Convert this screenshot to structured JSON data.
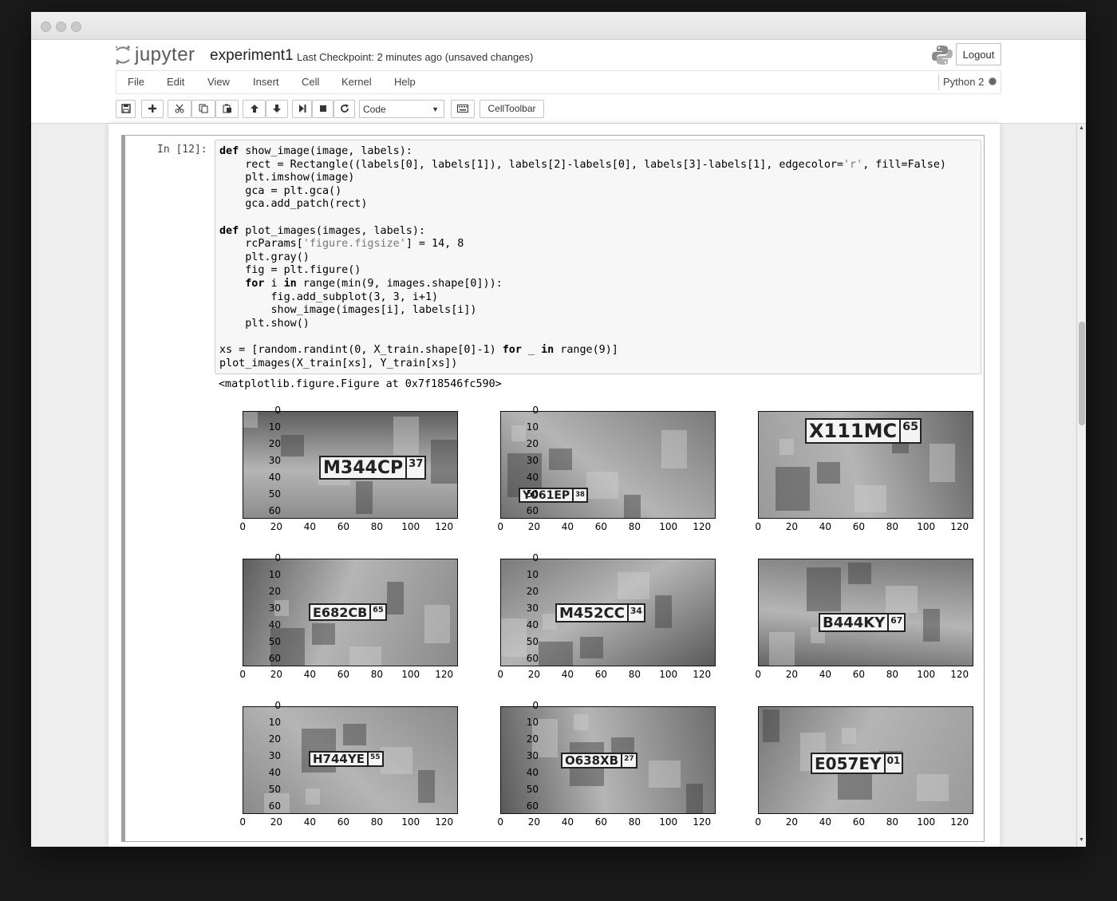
{
  "header": {
    "logo_text": "jupyter",
    "notebook_name": "experiment1",
    "checkpoint": "Last Checkpoint: 2 minutes ago (unsaved changes)",
    "logout_label": "Logout"
  },
  "menu": {
    "items": [
      "File",
      "Edit",
      "View",
      "Insert",
      "Cell",
      "Kernel",
      "Help"
    ],
    "kernel_name": "Python 2"
  },
  "toolbar": {
    "buttons": [
      "save-icon",
      "plus-icon",
      "scissors-icon",
      "copy-icon",
      "paste-icon",
      "arrow-up-icon",
      "arrow-down-icon",
      "step-forward-icon",
      "stop-icon",
      "refresh-icon",
      "keyboard-icon"
    ],
    "cell_type": "Code",
    "celltoolbar_label": "CellToolbar"
  },
  "cell": {
    "prompt": "In [12]:",
    "code_lines": [
      "def show_image(image, labels):",
      "    rect = Rectangle((labels[0], labels[1]), labels[2]-labels[0], labels[3]-labels[1], edgecolor='r', fill=False)",
      "    plt.imshow(image)",
      "    gca = plt.gca()",
      "    gca.add_patch(rect)",
      "",
      "def plot_images(images, labels):",
      "    rcParams['figure.figsize'] = 14, 8",
      "    plt.gray()",
      "    fig = plt.figure()",
      "    for i in range(min(9, images.shape[0])):",
      "        fig.add_subplot(3, 3, i+1)",
      "        show_image(images[i], labels[i])",
      "    plt.show()",
      "",
      "xs = [random.randint(0, X_train.shape[0]-1) for _ in range(9)]",
      "plot_images(X_train[xs], Y_train[xs])"
    ],
    "output_text": "<matplotlib.figure.Figure at 0x7f18546fc590>"
  },
  "plots": {
    "y_ticks": [
      "0",
      "10",
      "20",
      "30",
      "40",
      "50",
      "60"
    ],
    "x_ticks": [
      "0",
      "20",
      "40",
      "60",
      "80",
      "100",
      "120"
    ],
    "plates": [
      {
        "main": "M344CP",
        "region": "37"
      },
      {
        "main": "Y061EP",
        "region": "38"
      },
      {
        "main": "X111MC",
        "region": "65"
      },
      {
        "main": "E682CB",
        "region": "65"
      },
      {
        "main": "M452CC",
        "region": "34"
      },
      {
        "main": "B444KY",
        "region": "67"
      },
      {
        "main": "H744YE",
        "region": "55"
      },
      {
        "main": "O638XB",
        "region": "27"
      },
      {
        "main": "E057EY",
        "region": "01"
      }
    ]
  },
  "colors": {
    "plot_gray": "#8f8f8f",
    "cell_border": "#ababab",
    "code_bg": "#f7f7f7"
  }
}
